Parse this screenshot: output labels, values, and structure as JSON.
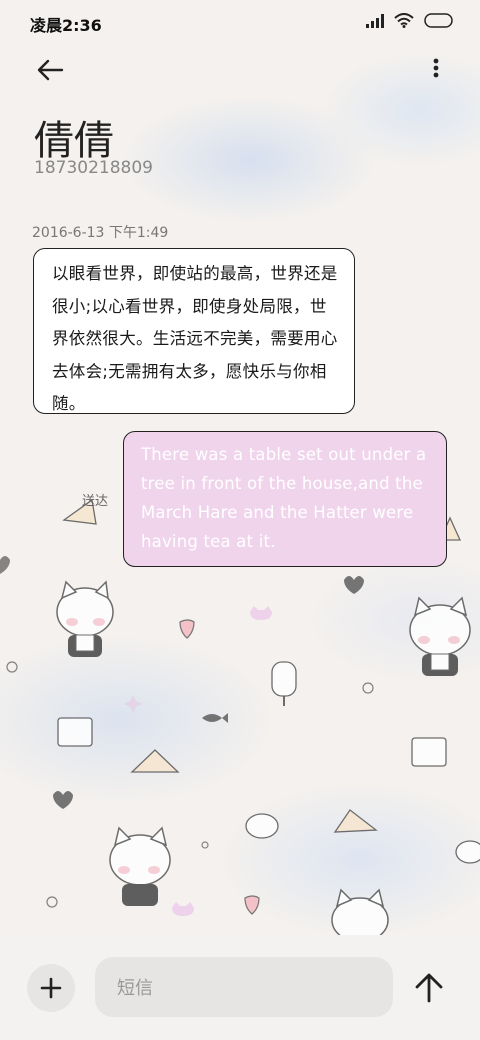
{
  "status_bar": {
    "time": "凌晨2:36",
    "icons": [
      "signal-icon",
      "wifi-icon",
      "battery-icon"
    ]
  },
  "top_bar": {
    "back_icon": "arrow-left-icon",
    "more_icon": "more-vertical-icon"
  },
  "contact": {
    "name": "倩倩",
    "number": "18730218809"
  },
  "conversation": {
    "timestamp": "2016-6-13 下午1:49",
    "incoming_message": "以眼看世界，即使站的最高，世界还是很小;以心看世界，即使身处局限，世界依然很大。生活远不完美，需要用心去体会;无需拥有太多，愿快乐与你相随。",
    "outgoing_message": "There was a table set out under a tree in front of the house,and the March Hare and the Hatter were having tea at it.",
    "sent_status": "送达"
  },
  "composer": {
    "add_icon": "plus-icon",
    "placeholder": "短信",
    "send_icon": "arrow-up-icon"
  },
  "colors": {
    "incoming_bubble": "#ffffff",
    "outgoing_bubble": "#efd4ec",
    "outgoing_text": "#ffffff",
    "background": "#f4f1ee"
  }
}
